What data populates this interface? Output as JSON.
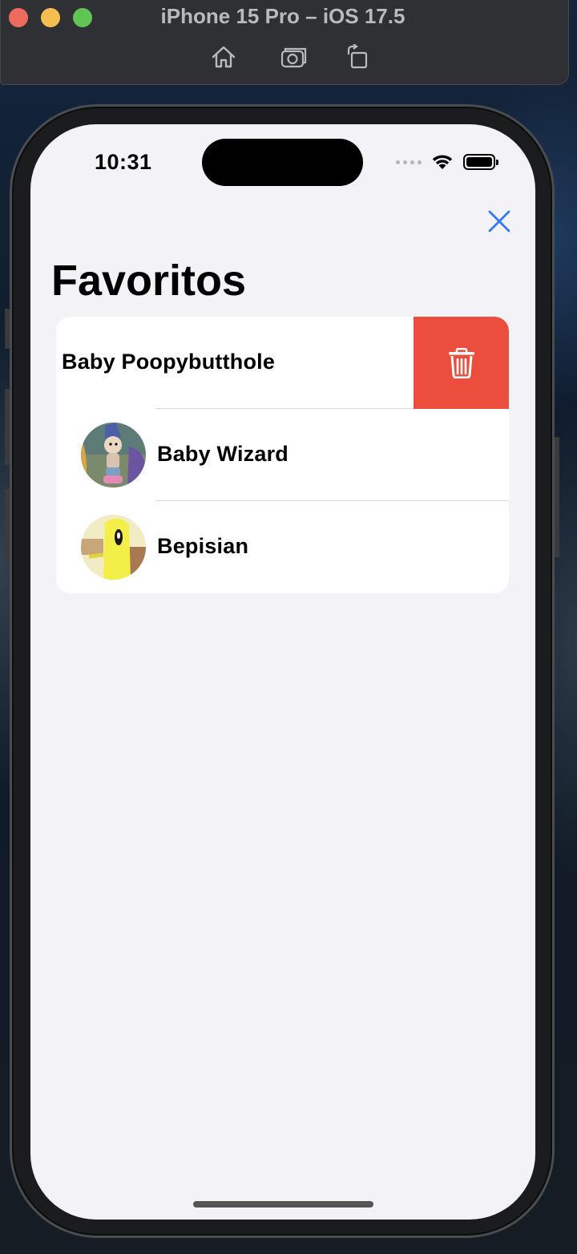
{
  "simulator": {
    "title": "iPhone 15 Pro – iOS 17.5",
    "tools": [
      "home-icon",
      "screenshot-icon",
      "rotate-icon"
    ]
  },
  "status_bar": {
    "time": "10:31"
  },
  "page": {
    "title": "Favoritos"
  },
  "favorites": [
    {
      "name": "Baby Poopybutthole",
      "swiped": true,
      "action": "trash-icon"
    },
    {
      "name": "Baby Wizard",
      "avatar": "baby-wizard-avatar"
    },
    {
      "name": "Bepisian",
      "avatar": "bepisian-avatar"
    }
  ],
  "colors": {
    "accent": "#3478f6",
    "delete": "#eb4e3d",
    "background": "#f2f2f7"
  }
}
